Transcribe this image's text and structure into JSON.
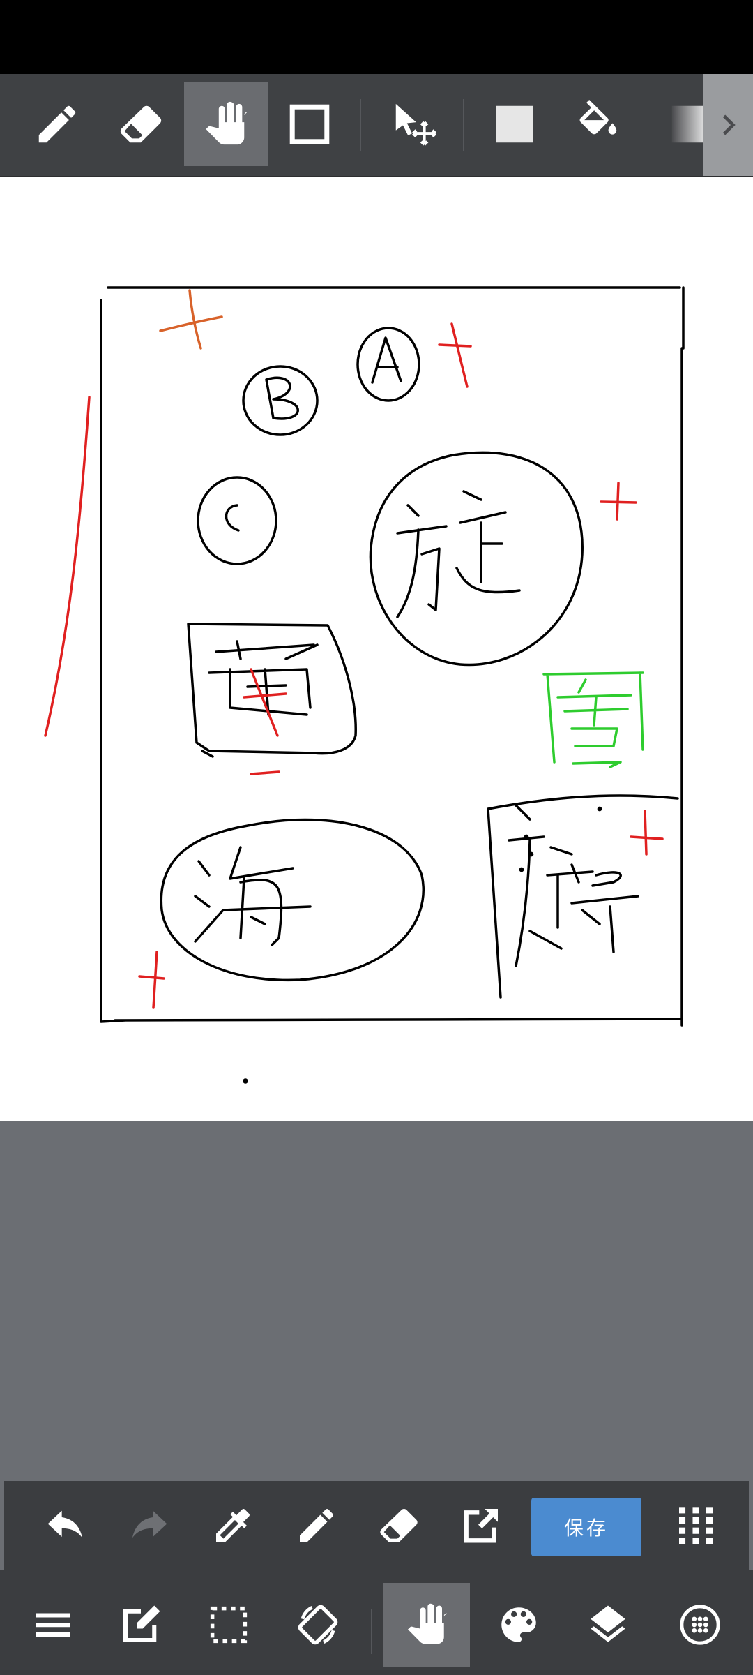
{
  "toolbar": {
    "tools": [
      {
        "icon": "pencil-icon",
        "active": false
      },
      {
        "icon": "eraser-icon",
        "active": false
      },
      {
        "icon": "hand-icon",
        "active": true
      },
      {
        "icon": "rectangle-icon",
        "active": false
      },
      {
        "icon": "select-move-icon",
        "active": false
      },
      {
        "icon": "fill-square-icon",
        "active": false
      },
      {
        "icon": "paint-bucket-icon",
        "active": false
      },
      {
        "icon": "gradient-icon",
        "active": false
      }
    ],
    "more_icon": "chevron-right-icon"
  },
  "bottom_bar_1": {
    "save_label": "保存",
    "icons": [
      "undo-icon",
      "redo-icon",
      "eyedropper-icon",
      "pencil-icon",
      "eraser-icon",
      "export-icon",
      "grid-menu-icon"
    ]
  },
  "bottom_bar_2": {
    "icons": [
      "menu-icon",
      "edit-icon",
      "selection-icon",
      "rotate-icon",
      "hand-icon",
      "palette-icon",
      "layers-icon",
      "brush-settings-icon"
    ]
  },
  "canvas": {
    "drawn_text": [
      "A",
      "B",
      "C",
      "旋",
      "海",
      "雪"
    ]
  },
  "colors": {
    "toolbar_bg": "#3f4144",
    "active_tool": "#6a6c70",
    "canvas_bg": "#ffffff",
    "workspace_bg": "#6b6e73",
    "save_button": "#4b8bd0",
    "ink_black": "#000000",
    "ink_red": "#e02020",
    "ink_orange": "#d8622a",
    "ink_green": "#2ecc2e"
  }
}
